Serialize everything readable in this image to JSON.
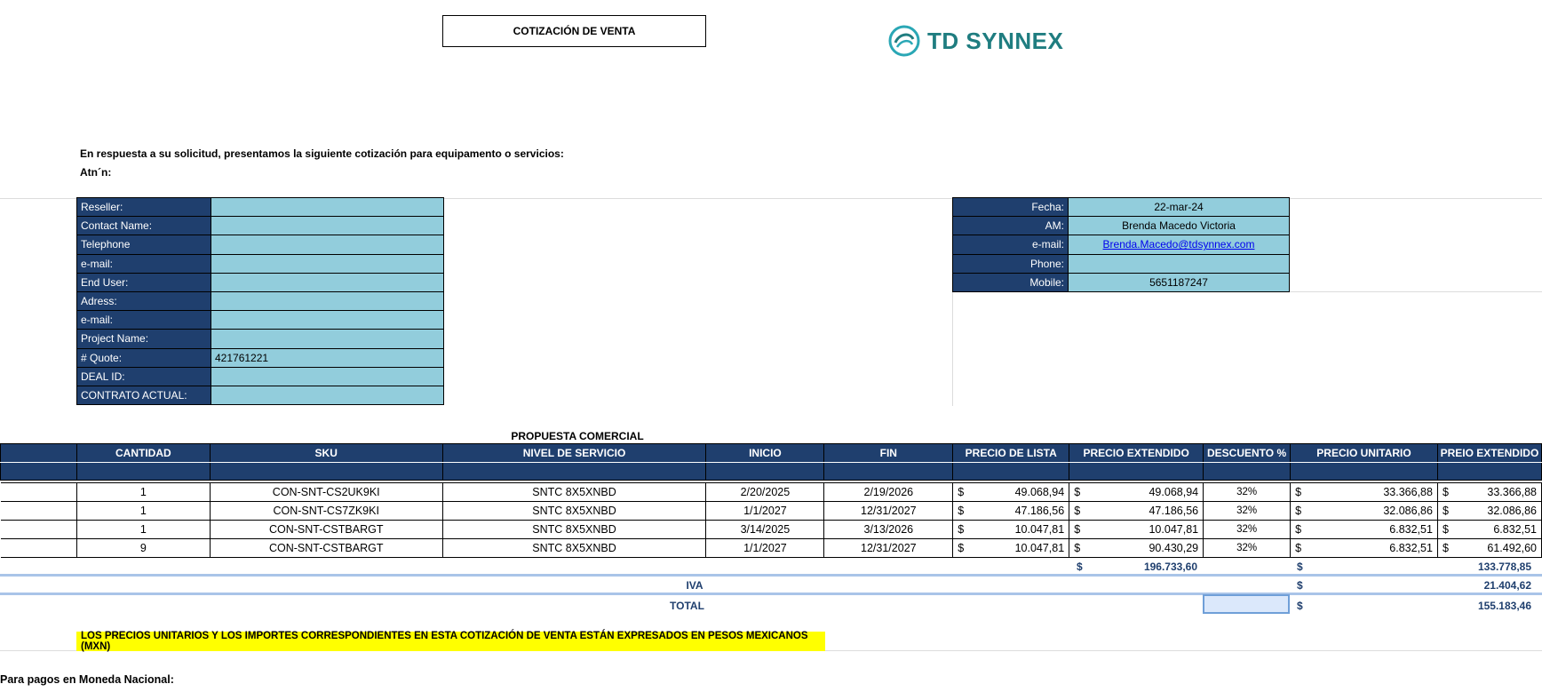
{
  "header": {
    "title": "COTIZACIÓN DE VENTA",
    "brand": "TD SYNNEX",
    "brand_color": "#1f7d80"
  },
  "intro": {
    "line1": "En respuesta a su solicitud, presentamos la siguiente cotización para equipamento o servicios:",
    "attention_label": "Atn´n:"
  },
  "customer": [
    {
      "label": "Reseller:",
      "value": ""
    },
    {
      "label": "Contact Name:",
      "value": ""
    },
    {
      "label": "Telephone",
      "value": ""
    },
    {
      "label": "e-mail:",
      "value": ""
    },
    {
      "label": "End User:",
      "value": ""
    },
    {
      "label": "Adress:",
      "value": ""
    },
    {
      "label": "e-mail:",
      "value": ""
    },
    {
      "label": "Project Name:",
      "value": ""
    },
    {
      "label": "# Quote:",
      "value": "421761221"
    },
    {
      "label": "DEAL ID:",
      "value": ""
    },
    {
      "label": "CONTRATO ACTUAL:",
      "value": ""
    }
  ],
  "account_manager": [
    {
      "label": "Fecha:",
      "value": "22-mar-24"
    },
    {
      "label": "AM:",
      "value": "Brenda Macedo Victoria"
    },
    {
      "label": "e-mail:",
      "value": "Brenda.Macedo@tdsynnex.com"
    },
    {
      "label": "Phone:",
      "value": ""
    },
    {
      "label": "Mobile:",
      "value": "5651187247"
    }
  ],
  "proposal": {
    "title": "PROPUESTA COMERCIAL",
    "columns": [
      "CANTIDAD",
      "SKU",
      "NIVEL DE SERVICIO",
      "INICIO",
      "FIN",
      "PRECIO DE LISTA",
      "PRECIO EXTENDIDO",
      "DESCUENTO %",
      "PRECIO UNITARIO",
      "PREIO EXTENDIDO"
    ],
    "currency_symbol": "$",
    "rows": [
      {
        "qty": "1",
        "sku": "CON-SNT-CS2UK9KI",
        "level": "SNTC 8X5XNBD",
        "start": "2/20/2025",
        "end": "2/19/2026",
        "list": "49.068,94",
        "ext": "49.068,94",
        "disc": "32%",
        "unit": "33.366,88",
        "ext2": "33.366,88"
      },
      {
        "qty": "1",
        "sku": "CON-SNT-CS7ZK9KI",
        "level": "SNTC 8X5XNBD",
        "start": "1/1/2027",
        "end": "12/31/2027",
        "list": "47.186,56",
        "ext": "47.186,56",
        "disc": "32%",
        "unit": "32.086,86",
        "ext2": "32.086,86"
      },
      {
        "qty": "1",
        "sku": "CON-SNT-CSTBARGT",
        "level": "SNTC 8X5XNBD",
        "start": "3/14/2025",
        "end": "3/13/2026",
        "list": "10.047,81",
        "ext": "10.047,81",
        "disc": "32%",
        "unit": "6.832,51",
        "ext2": "6.832,51"
      },
      {
        "qty": "9",
        "sku": "CON-SNT-CSTBARGT",
        "level": "SNTC 8X5XNBD",
        "start": "1/1/2027",
        "end": "12/31/2027",
        "list": "10.047,81",
        "ext": "90.430,29",
        "disc": "32%",
        "unit": "6.832,51",
        "ext2": "61.492,60"
      }
    ]
  },
  "totals": {
    "subtotal_ext": "196.733,60",
    "subtotal": "133.778,85",
    "iva_label": "IVA",
    "iva": "21.404,62",
    "total_label": "TOTAL",
    "total": "155.183,46"
  },
  "banner": "LOS PRECIOS UNITARIOS Y LOS IMPORTES CORRESPONDIENTES EN ESTA COTIZACIÓN DE VENTA ESTÁN EXPRESADOS EN PESOS MEXICANOS (MXN)",
  "footer": "Para pagos en Moneda Nacional:"
}
